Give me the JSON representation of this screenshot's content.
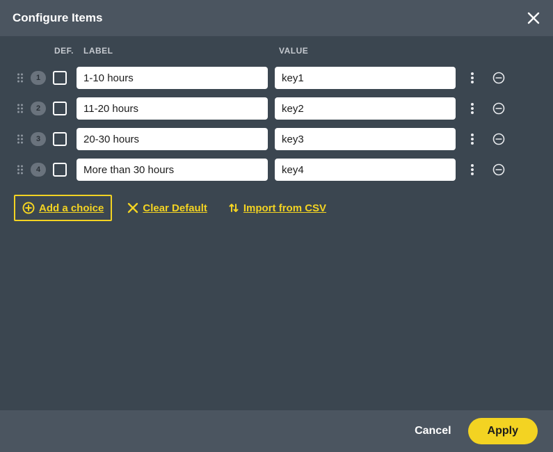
{
  "title": "Configure Items",
  "columns": {
    "def": "DEF.",
    "label": "LABEL",
    "value": "VALUE"
  },
  "rows": [
    {
      "index": "1",
      "label": "1-10 hours",
      "value": "key1",
      "default": false
    },
    {
      "index": "2",
      "label": "11-20 hours",
      "value": "key2",
      "default": false
    },
    {
      "index": "3",
      "label": "20-30 hours",
      "value": "key3",
      "default": false
    },
    {
      "index": "4",
      "label": "More than 30 hours",
      "value": "key4",
      "default": false
    }
  ],
  "actions": {
    "add": "Add a choice",
    "clear": "Clear Default",
    "import": "Import from CSV"
  },
  "footer": {
    "cancel": "Cancel",
    "apply": "Apply"
  }
}
